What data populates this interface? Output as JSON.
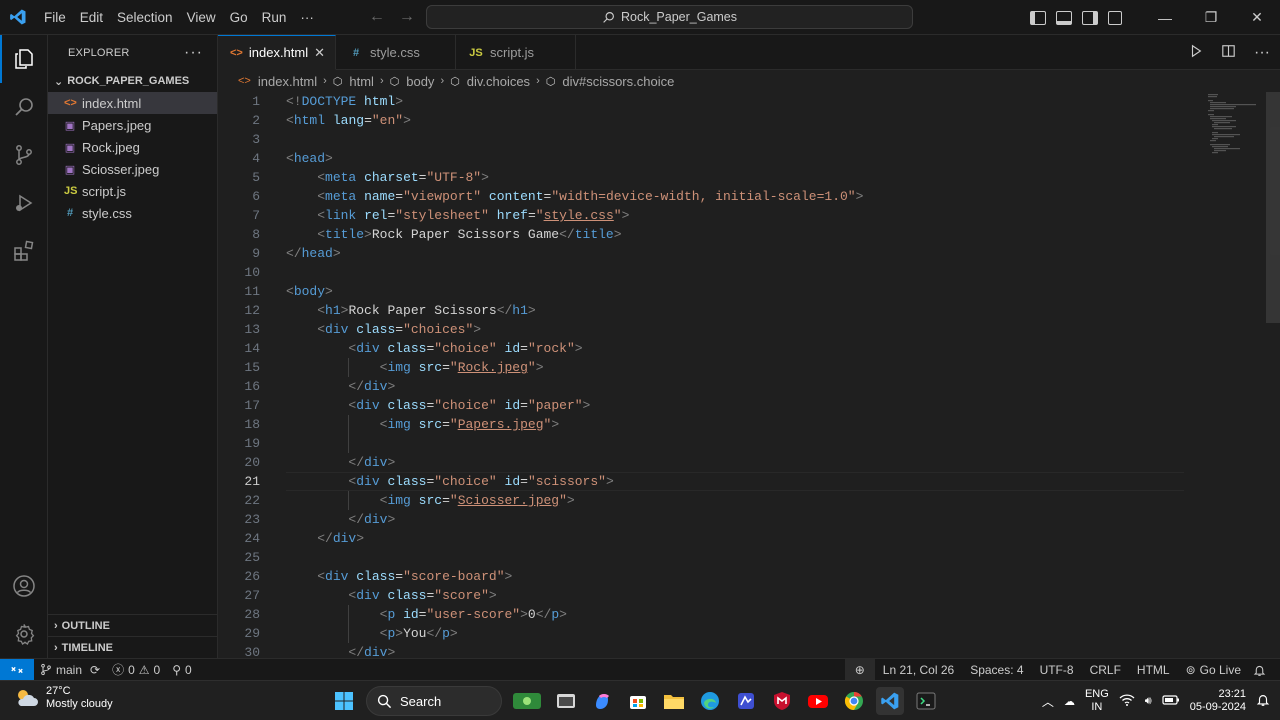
{
  "window": {
    "command_center": "Rock_Paper_Games"
  },
  "menu": [
    "File",
    "Edit",
    "Selection",
    "View",
    "Go",
    "Run",
    "···"
  ],
  "sidebar": {
    "header": "EXPLORER",
    "folder": "ROCK_PAPER_GAMES",
    "files": [
      {
        "name": "index.html",
        "icon": "html-file-icon",
        "glyph": "<>",
        "color": "#e37933"
      },
      {
        "name": "Papers.jpeg",
        "icon": "image-file-icon",
        "glyph": "▣",
        "color": "#a074c4"
      },
      {
        "name": "Rock.jpeg",
        "icon": "image-file-icon",
        "glyph": "▣",
        "color": "#a074c4"
      },
      {
        "name": "Sciosser.jpeg",
        "icon": "image-file-icon",
        "glyph": "▣",
        "color": "#a074c4"
      },
      {
        "name": "script.js",
        "icon": "js-file-icon",
        "glyph": "JS",
        "color": "#cbcb41"
      },
      {
        "name": "style.css",
        "icon": "css-file-icon",
        "glyph": "#",
        "color": "#519aba"
      }
    ],
    "outline": "OUTLINE",
    "timeline": "TIMELINE"
  },
  "tabs": [
    {
      "label": "index.html",
      "glyph": "<>",
      "color": "#e37933",
      "active": true
    },
    {
      "label": "style.css",
      "glyph": "#",
      "color": "#519aba",
      "active": false
    },
    {
      "label": "script.js",
      "glyph": "JS",
      "color": "#cbcb41",
      "active": false
    }
  ],
  "breadcrumb": [
    "index.html",
    "html",
    "body",
    "div.choices",
    "div#scissors.choice"
  ],
  "editor": {
    "current_line": 21,
    "lines": [
      [
        [
          "br",
          "<!"
        ],
        [
          "tag",
          "DOCTYPE"
        ],
        [
          "txt",
          " "
        ],
        [
          "attr",
          "html"
        ],
        [
          "br",
          ">"
        ]
      ],
      [
        [
          "br",
          "<"
        ],
        [
          "tag",
          "html"
        ],
        [
          "txt",
          " "
        ],
        [
          "attr",
          "lang"
        ],
        [
          "txt",
          "="
        ],
        [
          "str",
          "\"en\""
        ],
        [
          "br",
          ">"
        ]
      ],
      [],
      [
        [
          "br",
          "<"
        ],
        [
          "tag",
          "head"
        ],
        [
          "br",
          ">"
        ]
      ],
      [
        [
          "txt",
          "    "
        ],
        [
          "br",
          "<"
        ],
        [
          "tag",
          "meta"
        ],
        [
          "txt",
          " "
        ],
        [
          "attr",
          "charset"
        ],
        [
          "txt",
          "="
        ],
        [
          "str",
          "\"UTF-8\""
        ],
        [
          "br",
          ">"
        ]
      ],
      [
        [
          "txt",
          "    "
        ],
        [
          "br",
          "<"
        ],
        [
          "tag",
          "meta"
        ],
        [
          "txt",
          " "
        ],
        [
          "attr",
          "name"
        ],
        [
          "txt",
          "="
        ],
        [
          "str",
          "\"viewport\""
        ],
        [
          "txt",
          " "
        ],
        [
          "attr",
          "content"
        ],
        [
          "txt",
          "="
        ],
        [
          "str",
          "\"width=device-width, initial-scale=1.0\""
        ],
        [
          "br",
          ">"
        ]
      ],
      [
        [
          "txt",
          "    "
        ],
        [
          "br",
          "<"
        ],
        [
          "tag",
          "link"
        ],
        [
          "txt",
          " "
        ],
        [
          "attr",
          "rel"
        ],
        [
          "txt",
          "="
        ],
        [
          "str",
          "\"stylesheet\""
        ],
        [
          "txt",
          " "
        ],
        [
          "attr",
          "href"
        ],
        [
          "txt",
          "="
        ],
        [
          "str",
          "\""
        ],
        [
          "strul",
          "style.css"
        ],
        [
          "str",
          "\""
        ],
        [
          "br",
          ">"
        ]
      ],
      [
        [
          "txt",
          "    "
        ],
        [
          "br",
          "<"
        ],
        [
          "tag",
          "title"
        ],
        [
          "br",
          ">"
        ],
        [
          "txt",
          "Rock Paper Sciss"
        ],
        [
          "txt",
          "ors Game"
        ],
        [
          "br",
          "</"
        ],
        [
          "tag",
          "title"
        ],
        [
          "br",
          ">"
        ]
      ],
      [
        [
          "br",
          "</"
        ],
        [
          "tag",
          "head"
        ],
        [
          "br",
          ">"
        ]
      ],
      [],
      [
        [
          "br",
          "<"
        ],
        [
          "tag",
          "body"
        ],
        [
          "br",
          ">"
        ]
      ],
      [
        [
          "txt",
          "    "
        ],
        [
          "br",
          "<"
        ],
        [
          "tag",
          "h1"
        ],
        [
          "br",
          ">"
        ],
        [
          "txt",
          "Rock Paper Scissors"
        ],
        [
          "br",
          "</"
        ],
        [
          "tag",
          "h1"
        ],
        [
          "br",
          ">"
        ]
      ],
      [
        [
          "txt",
          "    "
        ],
        [
          "br",
          "<"
        ],
        [
          "tag",
          "div"
        ],
        [
          "txt",
          " "
        ],
        [
          "attr",
          "class"
        ],
        [
          "txt",
          "="
        ],
        [
          "str",
          "\"choices\""
        ],
        [
          "br",
          ">"
        ]
      ],
      [
        [
          "txt",
          "        "
        ],
        [
          "br",
          "<"
        ],
        [
          "tag",
          "div"
        ],
        [
          "txt",
          " "
        ],
        [
          "attr",
          "class"
        ],
        [
          "txt",
          "="
        ],
        [
          "str",
          "\"choice\""
        ],
        [
          "txt",
          " "
        ],
        [
          "attr",
          "id"
        ],
        [
          "txt",
          "="
        ],
        [
          "str",
          "\"rock\""
        ],
        [
          "br",
          ">"
        ]
      ],
      [
        [
          "txt",
          "            "
        ],
        [
          "br",
          "<"
        ],
        [
          "tag",
          "img"
        ],
        [
          "txt",
          " "
        ],
        [
          "attr",
          "src"
        ],
        [
          "txt",
          "="
        ],
        [
          "str",
          "\""
        ],
        [
          "strul",
          "Rock.jpeg"
        ],
        [
          "str",
          "\""
        ],
        [
          "br",
          ">"
        ]
      ],
      [
        [
          "txt",
          "        "
        ],
        [
          "br",
          "</"
        ],
        [
          "tag",
          "div"
        ],
        [
          "br",
          ">"
        ]
      ],
      [
        [
          "txt",
          "        "
        ],
        [
          "br",
          "<"
        ],
        [
          "tag",
          "div"
        ],
        [
          "txt",
          " "
        ],
        [
          "attr",
          "class"
        ],
        [
          "txt",
          "="
        ],
        [
          "str",
          "\"choice\""
        ],
        [
          "txt",
          " "
        ],
        [
          "attr",
          "id"
        ],
        [
          "txt",
          "="
        ],
        [
          "str",
          "\"paper\""
        ],
        [
          "br",
          ">"
        ]
      ],
      [
        [
          "txt",
          "            "
        ],
        [
          "br",
          "<"
        ],
        [
          "tag",
          "img"
        ],
        [
          "txt",
          " "
        ],
        [
          "attr",
          "src"
        ],
        [
          "txt",
          "="
        ],
        [
          "str",
          "\""
        ],
        [
          "strul",
          "Papers.jpeg"
        ],
        [
          "str",
          "\""
        ],
        [
          "br",
          ">"
        ]
      ],
      [],
      [
        [
          "txt",
          "        "
        ],
        [
          "br",
          "</"
        ],
        [
          "tag",
          "div"
        ],
        [
          "br",
          ">"
        ]
      ],
      [
        [
          "txt",
          "        "
        ],
        [
          "br",
          "<"
        ],
        [
          "tag",
          "div"
        ],
        [
          "txt",
          " "
        ],
        [
          "attr",
          "class"
        ],
        [
          "txt",
          "="
        ],
        [
          "str",
          "\"choice\""
        ],
        [
          "txt",
          " "
        ],
        [
          "attr",
          "id"
        ],
        [
          "txt",
          "="
        ],
        [
          "str",
          "\"scissors\""
        ],
        [
          "br",
          ">"
        ]
      ],
      [
        [
          "txt",
          "            "
        ],
        [
          "br",
          "<"
        ],
        [
          "tag",
          "img"
        ],
        [
          "txt",
          " "
        ],
        [
          "attr",
          "src"
        ],
        [
          "txt",
          "="
        ],
        [
          "str",
          "\""
        ],
        [
          "strul",
          "Sciosser.jpeg"
        ],
        [
          "str",
          "\""
        ],
        [
          "br",
          ">"
        ]
      ],
      [
        [
          "txt",
          "        "
        ],
        [
          "br",
          "</"
        ],
        [
          "tag",
          "div"
        ],
        [
          "br",
          ">"
        ]
      ],
      [
        [
          "txt",
          "    "
        ],
        [
          "br",
          "</"
        ],
        [
          "tag",
          "div"
        ],
        [
          "br",
          ">"
        ]
      ],
      [],
      [
        [
          "txt",
          "    "
        ],
        [
          "br",
          "<"
        ],
        [
          "tag",
          "div"
        ],
        [
          "txt",
          " "
        ],
        [
          "attr",
          "class"
        ],
        [
          "txt",
          "="
        ],
        [
          "str",
          "\"score-board\""
        ],
        [
          "br",
          ">"
        ]
      ],
      [
        [
          "txt",
          "        "
        ],
        [
          "br",
          "<"
        ],
        [
          "tag",
          "div"
        ],
        [
          "txt",
          " "
        ],
        [
          "attr",
          "class"
        ],
        [
          "txt",
          "="
        ],
        [
          "str",
          "\"score\""
        ],
        [
          "br",
          ">"
        ]
      ],
      [
        [
          "txt",
          "            "
        ],
        [
          "br",
          "<"
        ],
        [
          "tag",
          "p"
        ],
        [
          "txt",
          " "
        ],
        [
          "attr",
          "id"
        ],
        [
          "txt",
          "="
        ],
        [
          "str",
          "\"user-score\""
        ],
        [
          "br",
          ">"
        ],
        [
          "txt",
          "0"
        ],
        [
          "br",
          "</"
        ],
        [
          "tag",
          "p"
        ],
        [
          "br",
          ">"
        ]
      ],
      [
        [
          "txt",
          "            "
        ],
        [
          "br",
          "<"
        ],
        [
          "tag",
          "p"
        ],
        [
          "br",
          ">"
        ],
        [
          "txt",
          "You"
        ],
        [
          "br",
          "</"
        ],
        [
          "tag",
          "p"
        ],
        [
          "br",
          ">"
        ]
      ],
      [
        [
          "txt",
          "        "
        ],
        [
          "br",
          "</"
        ],
        [
          "tag",
          "div"
        ],
        [
          "br",
          ">"
        ]
      ]
    ]
  },
  "status": {
    "branch": "main",
    "errors": "0",
    "warnings": "0",
    "ports": "0",
    "position": "Ln 21, Col 26",
    "spaces": "Spaces: 4",
    "encoding": "UTF-8",
    "eol": "CRLF",
    "language": "HTML",
    "golive": "Go Live"
  },
  "taskbar": {
    "temperature": "27°C",
    "weather": "Mostly cloudy",
    "search": "Search",
    "lang1": "ENG",
    "lang2": "IN",
    "time": "23:21",
    "date": "05-09-2024"
  },
  "colors": {
    "accent": "#0078d4",
    "editor_bg": "#1f1f1f",
    "chrome_bg": "#181818"
  }
}
